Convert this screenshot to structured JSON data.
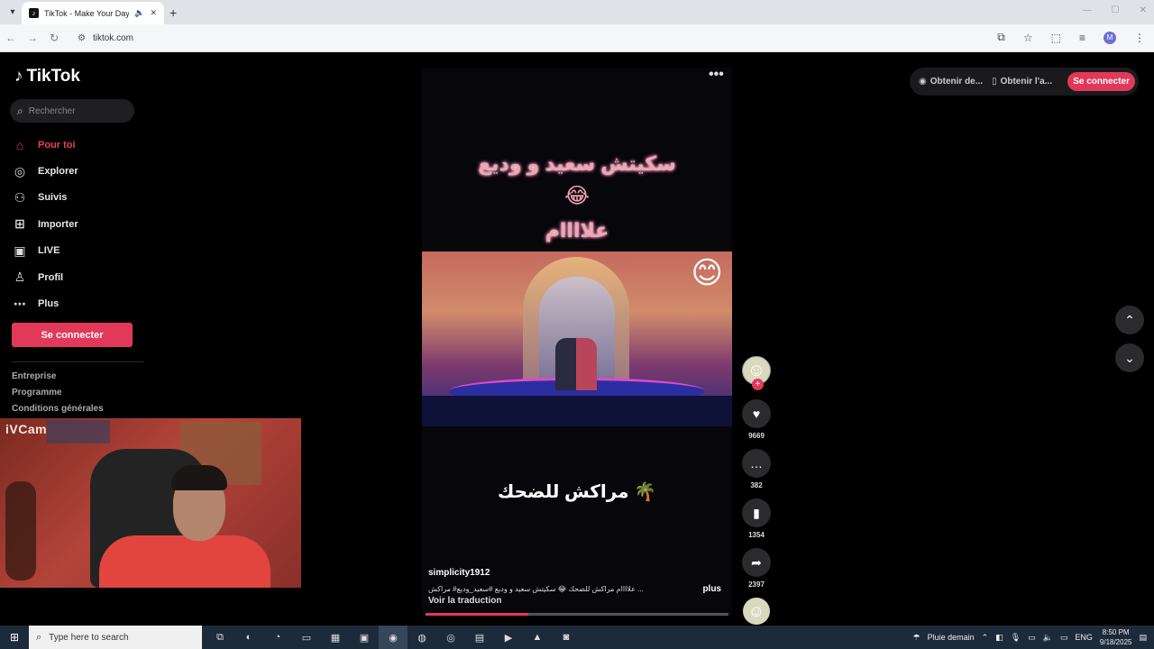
{
  "browser": {
    "tab_title": "TikTok - Make Your Day",
    "url": "tiktok.com",
    "profile_initial": "M"
  },
  "tiktok": {
    "logo": "TikTok",
    "search_placeholder": "Rechercher",
    "nav": [
      {
        "label": "Pour toi",
        "icon": "home-icon",
        "active": true
      },
      {
        "label": "Explorer",
        "icon": "compass-icon"
      },
      {
        "label": "Suivis",
        "icon": "following-icon"
      },
      {
        "label": "Importer",
        "icon": "upload-icon"
      },
      {
        "label": "LIVE",
        "icon": "live-icon"
      },
      {
        "label": "Profil",
        "icon": "profile-icon"
      },
      {
        "label": "Plus",
        "icon": "more-icon"
      }
    ],
    "login_label": "Se connecter",
    "footer": [
      "Entreprise",
      "Programme",
      "Conditions générales"
    ],
    "top_right": {
      "coins_label": "Obtenir de...",
      "app_label": "Obtenir l'a...",
      "login_label": "Se connecter"
    }
  },
  "video": {
    "overlay_line1": "سكيتش سعيد و وديع",
    "overlay_emoji": "😂",
    "overlay_line2": "علاااام",
    "stage_emoji": "😊",
    "caption_mid": "مراكش للضحك 🌴",
    "author": "simplicity1912",
    "description": "علاااام مراكش للضحك 😂 سكيتش سعيد و وديع #سعيد_وديع# مراكش ...",
    "more_label": "plus",
    "translate_label": "Voir la traduction",
    "progress": 0.34
  },
  "actions": {
    "likes": "9669",
    "comments": "382",
    "saves": "1354",
    "shares": "2397"
  },
  "webcam": {
    "label": "iVCam"
  },
  "taskbar": {
    "search_placeholder": "Type here to search",
    "weather": "Pluie demain",
    "language": "ENG",
    "time": "8:50 PM",
    "date": "9/18/2025"
  }
}
